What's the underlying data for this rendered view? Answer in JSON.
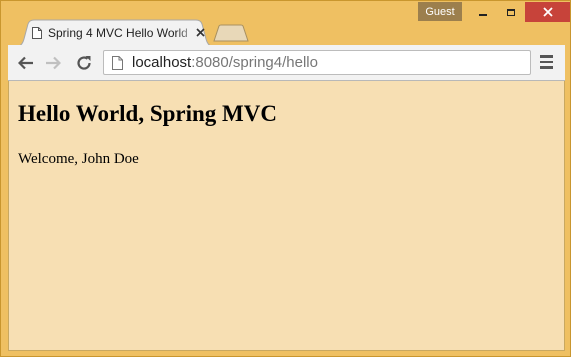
{
  "window": {
    "profile_label": "Guest",
    "frame_color": "#efc062",
    "close_color": "#c7433a"
  },
  "tab": {
    "title": "Spring 4 MVC Hello World",
    "icon": "page-icon",
    "close_icon": "close-icon"
  },
  "toolbar": {
    "back_icon": "arrow-left-icon",
    "forward_icon": "arrow-right-icon",
    "reload_icon": "reload-icon",
    "menu_icon": "hamburger-menu-icon"
  },
  "omnibox": {
    "url_host": "localhost",
    "url_rest": ":8080/spring4/hello"
  },
  "page": {
    "heading": "Hello World, Spring MVC",
    "welcome": "Welcome, John Doe",
    "background": "#f7dfb3"
  }
}
